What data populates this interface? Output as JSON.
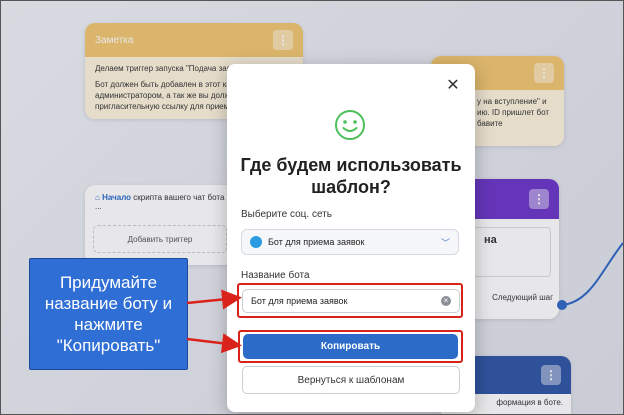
{
  "bg_cards": {
    "note_card": {
      "title": "Заметка",
      "body_1": "Делаем триггер запуска \"Подача заявк",
      "body_2": "Бот должен быть добавлен в этот кана",
      "body_3": "администратором, а так же вы должн",
      "body_4": "пригласительную ссылку для приема з"
    },
    "right_top_card": {
      "body_1": "у на вступление\" и",
      "body_2": "ию. ID пришлет бот",
      "body_3": "бавите"
    },
    "start_card": {
      "start_label": "Начало",
      "start_text": "скрипта вашего чат бота ...",
      "add_trigger": "Добавить триггер"
    },
    "purple_card": {
      "text": "на",
      "next_step": "Следующий шаг"
    },
    "navy_card": {
      "text": "формация в боте."
    }
  },
  "modal": {
    "title": "Где будем использовать шаблон?",
    "network_label": "Выберите соц. сеть",
    "network_value": "Бот для приема заявок",
    "bot_name_label": "Название бота",
    "bot_name_value": "Бот для приема заявок",
    "copy_button": "Копировать",
    "back_button": "Вернуться к шаблонам"
  },
  "callout": {
    "text": "Придумайте название боту и нажмите \"Копировать\""
  },
  "colors": {
    "accent": "#2c6bc8",
    "annotation_red": "#d9231a",
    "smiley_green": "#4cbf5a",
    "note_orange": "#f2c670",
    "purple": "#6a35c9"
  }
}
